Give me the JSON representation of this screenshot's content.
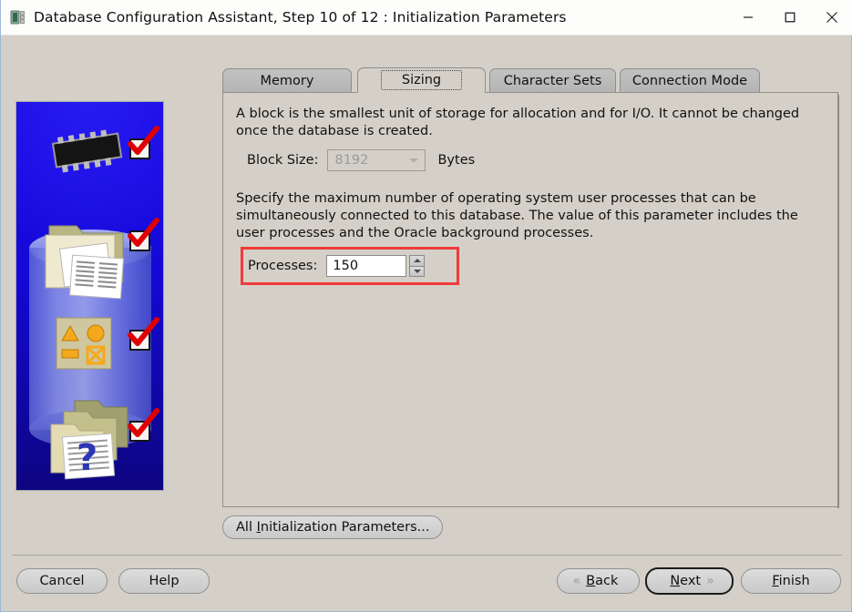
{
  "window": {
    "title": "Database Configuration Assistant, Step 10 of 12 : Initialization Parameters",
    "icon": "database-chip-icon",
    "controls": {
      "minimize": "minimize-icon",
      "maximize": "maximize-icon",
      "close": "close-icon"
    }
  },
  "sidebar": {
    "icons": [
      "memory-chip-icon",
      "file-documents-icon",
      "shapes-palette-icon",
      "folders-question-icon"
    ],
    "checks": [
      "check-1",
      "check-2",
      "check-3",
      "check-4"
    ]
  },
  "tabs": [
    {
      "label": "Memory",
      "selected": false
    },
    {
      "label": "Sizing",
      "selected": true
    },
    {
      "label": "Character Sets",
      "selected": false
    },
    {
      "label": "Connection Mode",
      "selected": false
    }
  ],
  "panel": {
    "block_paragraph": "A block is the smallest unit of storage for allocation and for I/O. It cannot be changed once the database is created.",
    "block_size": {
      "label": "Block Size:",
      "value": "8192",
      "unit": "Bytes",
      "enabled": false,
      "arrow_icon": "chevron-down-icon"
    },
    "processes_paragraph": "Specify the maximum number of operating system user processes that can be simultaneously connected to this database. The value of this parameter includes the user processes and the Oracle background processes.",
    "processes": {
      "label": "Processes:",
      "value": "150",
      "up_icon": "spinner-up-icon",
      "down_icon": "spinner-down-icon"
    }
  },
  "buttons": {
    "all_parameters": "All Initialization Parameters...",
    "all_parameters_mnemonic": "I",
    "cancel": "Cancel",
    "help": "Help",
    "back": "Back",
    "back_mnemonic": "B",
    "next": "Next",
    "next_mnemonic": "N",
    "finish": "Finish",
    "finish_mnemonic": "F",
    "back_chevron": "chevron-left-double-icon",
    "next_chevron": "chevron-right-double-icon"
  },
  "annotation": {
    "target": "processes-field",
    "color": "#ef3b3b"
  },
  "colors": {
    "window_bg": "#d4d0c8",
    "titlebar_bg": "#fdfdfb",
    "tab_unselected": "#bcbcbc",
    "sidebar_blue": "#1407e0",
    "annotation_red": "#ef3b3b"
  }
}
